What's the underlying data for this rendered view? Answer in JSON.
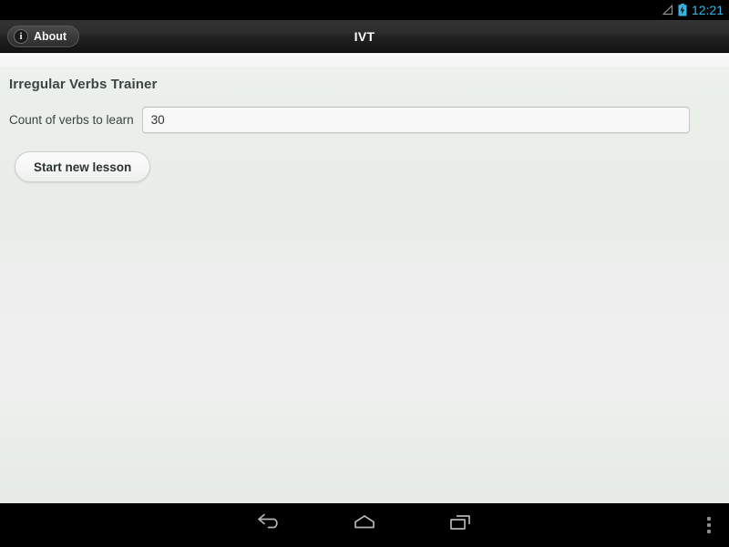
{
  "status_bar": {
    "clock": "12:21",
    "clock_color": "#33b5e5",
    "signal_icon": "signal-triangle-icon",
    "battery_icon": "battery-charging-icon"
  },
  "action_bar": {
    "title": "IVT",
    "about_label": "About",
    "about_icon": "info-icon"
  },
  "content": {
    "page_title": "Irregular Verbs Trainer",
    "count_label": "Count of verbs to learn",
    "count_value": "30",
    "count_placeholder": "",
    "start_button_label": "Start new lesson"
  },
  "nav_bar": {
    "back_icon": "back-arrow-icon",
    "home_icon": "home-icon",
    "recents_icon": "recent-apps-icon",
    "menu_icon": "overflow-menu-icon"
  },
  "colors": {
    "accent": "#33b5e5",
    "action_bar": "#2b2b2b",
    "content_bg": "#e9eee9",
    "nav_bar": "#000000"
  }
}
